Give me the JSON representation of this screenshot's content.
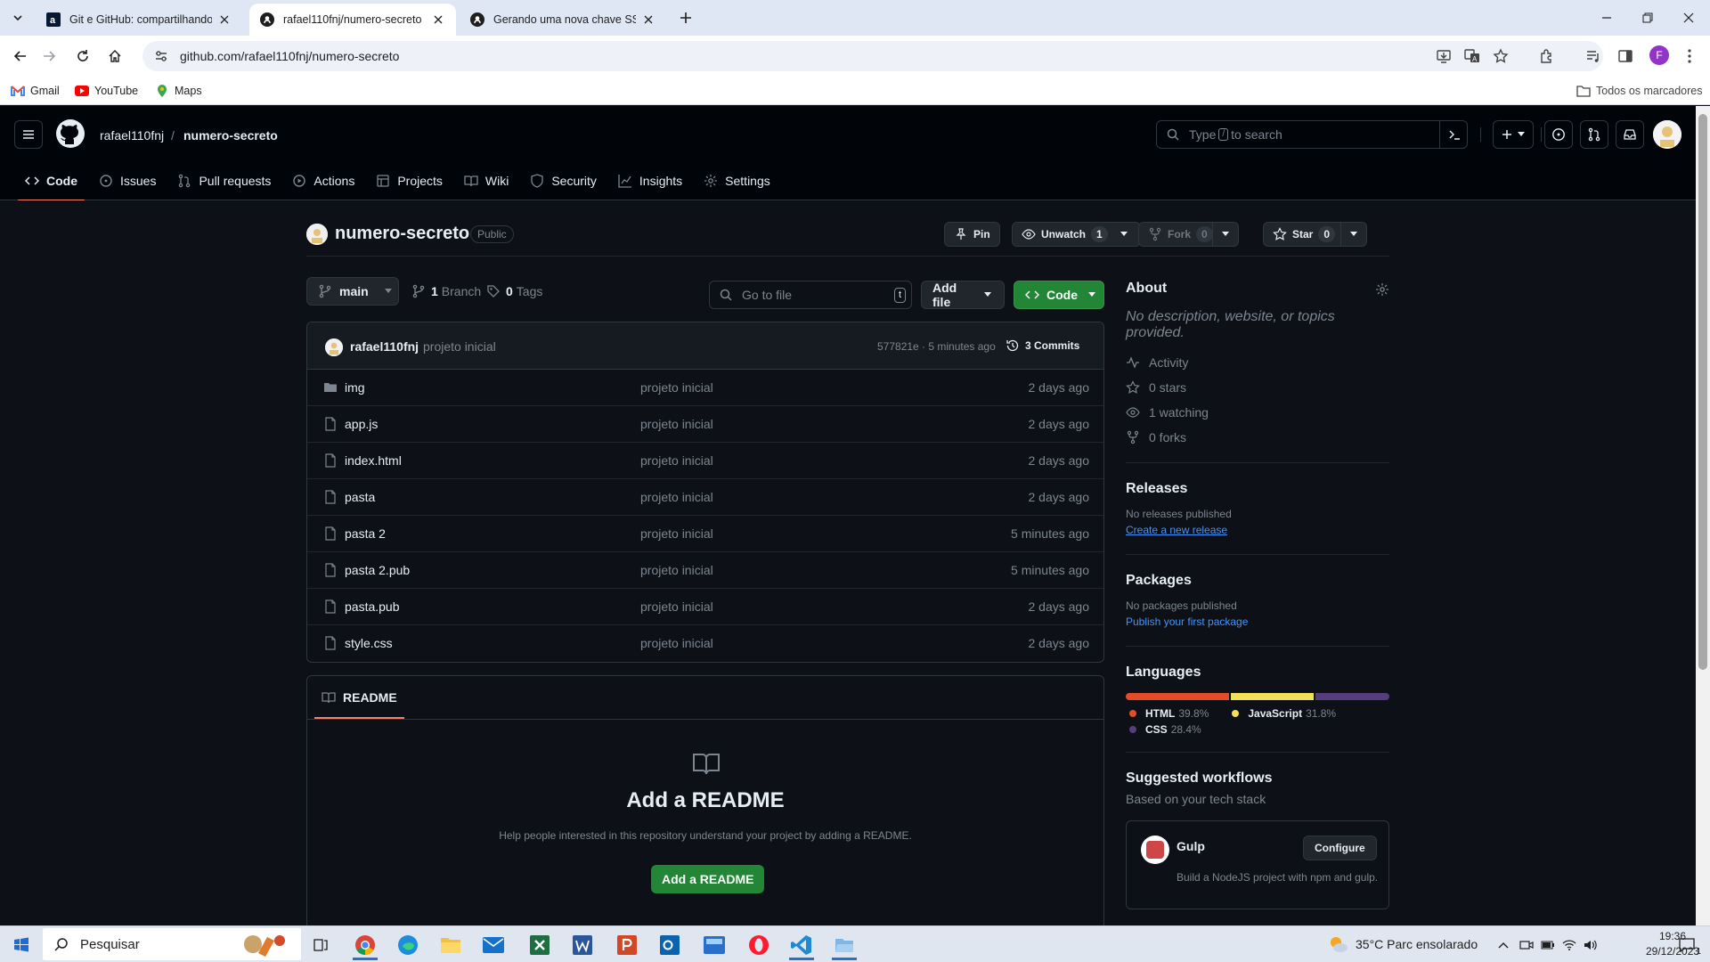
{
  "browser": {
    "tabs": [
      {
        "title": "Git e GitHub: compartilhando e"
      },
      {
        "title": "rafael110fnj/numero-secreto"
      },
      {
        "title": "Gerando uma nova chave SSH e"
      }
    ],
    "url": "github.com/rafael110fnj/numero-secreto",
    "profile_initial": "F",
    "bookmarks": [
      {
        "label": "Gmail"
      },
      {
        "label": "YouTube"
      },
      {
        "label": "Maps"
      }
    ],
    "all_bookmarks": "Todos os marcadores"
  },
  "github": {
    "owner": "rafael110fnj",
    "separator": "/",
    "repo": "numero-secreto",
    "search": {
      "before": "Type",
      "key": "/",
      "after": "to search"
    },
    "nav": [
      {
        "label": "Code",
        "icon": "code-icon"
      },
      {
        "label": "Issues",
        "icon": "issue-icon"
      },
      {
        "label": "Pull requests",
        "icon": "pull-request-icon"
      },
      {
        "label": "Actions",
        "icon": "play-icon"
      },
      {
        "label": "Projects",
        "icon": "table-icon"
      },
      {
        "label": "Wiki",
        "icon": "book-icon"
      },
      {
        "label": "Security",
        "icon": "shield-icon"
      },
      {
        "label": "Insights",
        "icon": "graph-icon"
      },
      {
        "label": "Settings",
        "icon": "gear-icon"
      }
    ]
  },
  "repo": {
    "name": "numero-secreto",
    "visibility": "Public",
    "pin": "Pin",
    "unwatch": "Unwatch",
    "watch_count": "1",
    "fork": "Fork",
    "fork_count": "0",
    "star": "Star",
    "star_count": "0",
    "branch": "main",
    "branches": {
      "count": "1",
      "label": "Branch"
    },
    "tags": {
      "count": "0",
      "label": "Tags"
    },
    "go_to_file": "Go to file",
    "go_to_file_key": "t",
    "add_file": "Add file",
    "code_btn": "Code",
    "last_commit": {
      "author": "rafael110fnj",
      "message": "projeto inicial",
      "hash_time": "577821e · 5 minutes ago",
      "commits": "3 Commits"
    },
    "files": [
      {
        "name": "img",
        "type": "dir",
        "message": "projeto inicial",
        "date": "2 days ago"
      },
      {
        "name": "app.js",
        "type": "file",
        "message": "projeto inicial",
        "date": "2 days ago"
      },
      {
        "name": "index.html",
        "type": "file",
        "message": "projeto inicial",
        "date": "2 days ago"
      },
      {
        "name": "pasta",
        "type": "file",
        "message": "projeto inicial",
        "date": "2 days ago"
      },
      {
        "name": "pasta 2",
        "type": "file",
        "message": "projeto inicial",
        "date": "5 minutes ago"
      },
      {
        "name": "pasta 2.pub",
        "type": "file",
        "message": "projeto inicial",
        "date": "5 minutes ago"
      },
      {
        "name": "pasta.pub",
        "type": "file",
        "message": "projeto inicial",
        "date": "2 days ago"
      },
      {
        "name": "style.css",
        "type": "file",
        "message": "projeto inicial",
        "date": "2 days ago"
      }
    ],
    "readme": {
      "tab": "README",
      "title": "Add a README",
      "help": "Help people interested in this repository understand your project by adding a README.",
      "button": "Add a README"
    }
  },
  "sidebar": {
    "about": {
      "title": "About",
      "description": "No description, website, or topics provided.",
      "stats": [
        "Activity",
        "0 stars",
        "1 watching",
        "0 forks"
      ]
    },
    "releases": {
      "title": "Releases",
      "empty": "No releases published",
      "link": "Create a new release"
    },
    "packages": {
      "title": "Packages",
      "empty": "No packages published",
      "link": "Publish your first package"
    },
    "languages": {
      "title": "Languages",
      "items": [
        {
          "name": "HTML",
          "percent": "39.8%",
          "value": 39.8,
          "color": "#e34c26"
        },
        {
          "name": "JavaScript",
          "percent": "31.8%",
          "value": 31.8,
          "color": "#f1e05a"
        },
        {
          "name": "CSS",
          "percent": "28.4%",
          "value": 28.4,
          "color": "#563d7c"
        }
      ]
    },
    "workflows": {
      "title": "Suggested workflows",
      "subtitle": "Based on your tech stack",
      "card": {
        "name": "Gulp",
        "description": "Build a NodeJS project with npm and gulp.",
        "button": "Configure"
      }
    }
  },
  "taskbar": {
    "search_placeholder": "Pesquisar",
    "weather": "35°C  Parc ensolarado",
    "time": "19:36",
    "date": "29/12/2023",
    "notifications": "1"
  },
  "colors": {
    "accent_green": "#238636",
    "nav_underline": "#f78166",
    "link_blue": "#4493f8"
  }
}
